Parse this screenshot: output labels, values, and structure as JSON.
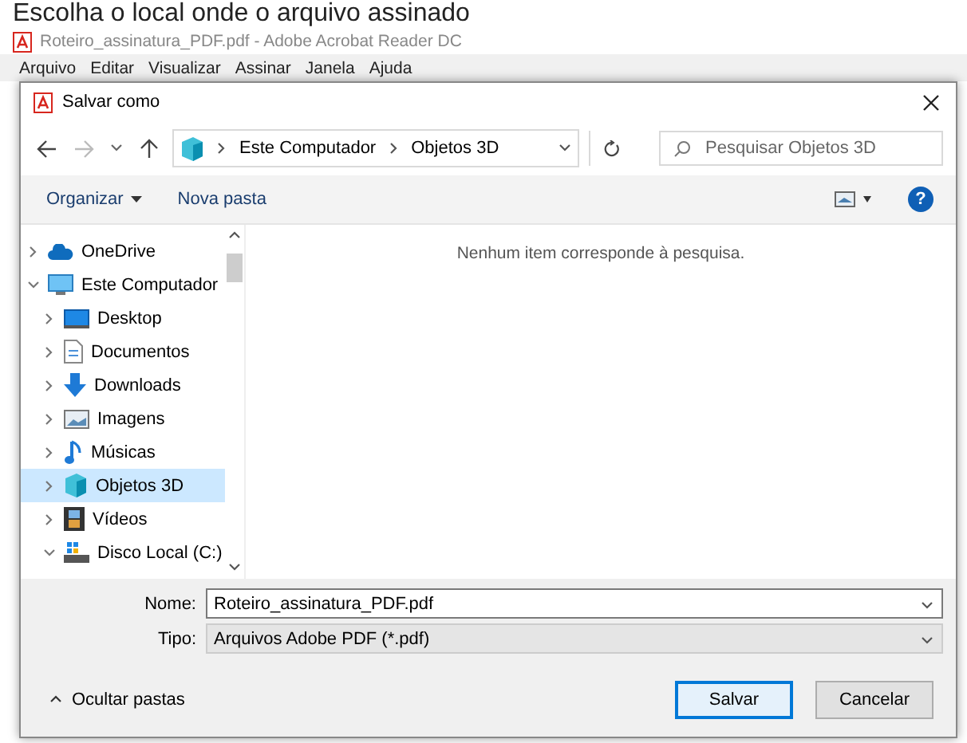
{
  "heading": "Escolha o local onde o arquivo assinado",
  "app_window": {
    "title": "Roteiro_assinatura_PDF.pdf - Adobe Acrobat Reader DC",
    "menu": [
      "Arquivo",
      "Editar",
      "Visualizar",
      "Assinar",
      "Janela",
      "Ajuda"
    ]
  },
  "dialog": {
    "title": "Salvar como",
    "breadcrumb": [
      "Este Computador",
      "Objetos 3D"
    ],
    "search": {
      "placeholder": "Pesquisar Objetos 3D"
    },
    "toolbar": [
      "Organizar",
      "Nova pasta"
    ],
    "help": "?",
    "tree": [
      {
        "label": "OneDrive",
        "kind": "cloud",
        "expanded": false,
        "selected": false
      },
      {
        "label": "Este Computador",
        "kind": "computer",
        "expanded": true,
        "selected": false,
        "children": [
          {
            "label": "Desktop",
            "kind": "desktop",
            "expanded": false,
            "selected": false
          },
          {
            "label": "Documentos",
            "kind": "document",
            "expanded": false,
            "selected": false
          },
          {
            "label": "Downloads",
            "kind": "download",
            "expanded": false,
            "selected": false
          },
          {
            "label": "Imagens",
            "kind": "picture",
            "expanded": false,
            "selected": false
          },
          {
            "label": "Músicas",
            "kind": "music",
            "expanded": false,
            "selected": false
          },
          {
            "label": "Objetos 3D",
            "kind": "cube",
            "expanded": false,
            "selected": true
          },
          {
            "label": "Vídeos",
            "kind": "video",
            "expanded": false,
            "selected": false
          },
          {
            "label": "Disco Local (C:)",
            "kind": "drive",
            "expanded": true,
            "selected": false
          }
        ]
      }
    ],
    "empty_message": "Nenhum item corresponde à pesquisa.",
    "fields": [
      {
        "label": "Nome:",
        "value": "Roteiro_assinatura_PDF.pdf",
        "kind": "input"
      },
      {
        "label": "Tipo:",
        "value": "Arquivos Adobe PDF (*.pdf)",
        "kind": "select"
      }
    ],
    "hide_folders": "Ocultar pastas",
    "buttons": [
      {
        "label": "Salvar",
        "kind": "primary"
      },
      {
        "label": "Cancelar",
        "kind": "secondary"
      }
    ]
  }
}
